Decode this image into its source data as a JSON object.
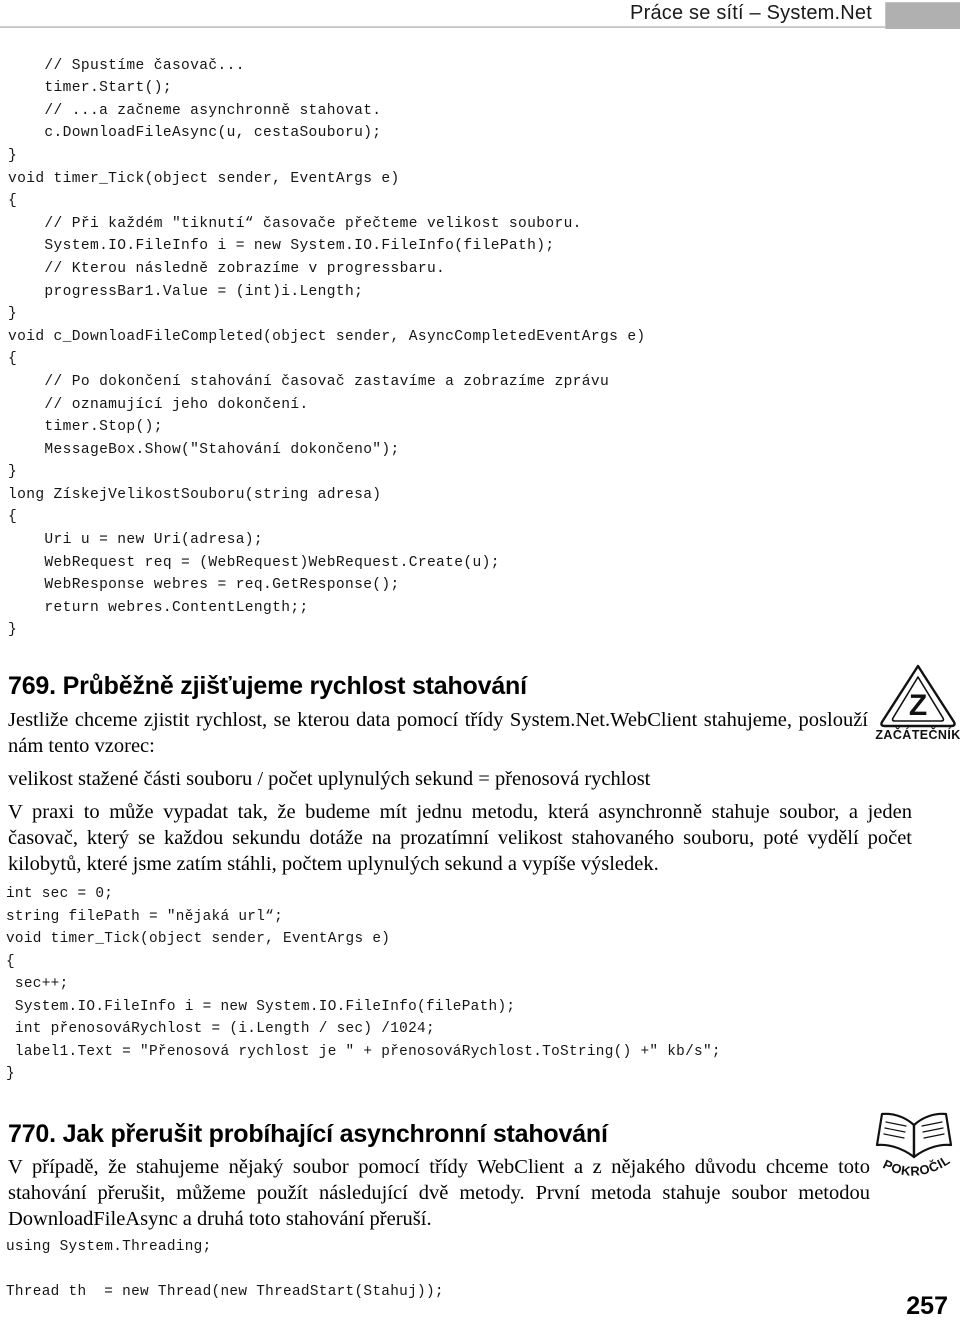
{
  "header": {
    "title": "Práce se sítí – System.Net",
    "tab_color": "#b0b0b0"
  },
  "code_block_1": "    // Spustíme časovač...\n    timer.Start();\n    // ...a začneme asynchronně stahovat.\n    c.DownloadFileAsync(u, cestaSouboru);\n}\nvoid timer_Tick(object sender, EventArgs e)\n{\n    // Při každém \"tiknutí“ časovače přečteme velikost souboru.\n    System.IO.FileInfo i = new System.IO.FileInfo(filePath);\n    // Kterou následně zobrazíme v progressbaru.\n    progressBar1.Value = (int)i.Length;\n}\nvoid c_DownloadFileCompleted(object sender, AsyncCompletedEventArgs e)\n{\n    // Po dokončení stahování časovač zastavíme a zobrazíme zprávu\n    // oznamující jeho dokončení.\n    timer.Stop();\n    MessageBox.Show(\"Stahování dokončeno\");\n}\nlong ZískejVelikostSouboru(string adresa)\n{\n    Uri u = new Uri(adresa);\n    WebRequest req = (WebRequest)WebRequest.Create(u);\n    WebResponse webres = req.GetResponse();\n    return webres.ContentLength;;\n}",
  "section_769": {
    "heading": "769. Průběžně zjišťujeme rychlost stahování",
    "paragraph_1": "Jestliže chceme zjistit rychlost, se kterou data pomocí třídy System.Net.WebClient stahujeme, poslouží nám tento vzorec:",
    "formula": "velikost stažené části souboru / počet uplynulých sekund = přenosová rychlost",
    "paragraph_2": "V praxi to může vypadat tak, že budeme mít jednu metodu, která asynchronně stahuje soubor, a jeden časovač, který se každou sekundu dotáže na prozatímní velikost stahovaného souboru, poté vydělí počet kilobytů, které jsme zatím stáhli, počtem uplynulých sekund a vypíše výsledek."
  },
  "code_block_2": "int sec = 0;\nstring filePath = \"nějaká url“;\nvoid timer_Tick(object sender, EventArgs e)\n{\n sec++;\n System.IO.FileInfo i = new System.IO.FileInfo(filePath);\n int přenosováRychlost = (i.Length / sec) /1024;\n label1.Text = \"Přenosová rychlost je \" + přenosováRychlost.ToString() +\" kb/s\";\n}",
  "section_770": {
    "heading": "770. Jak přerušit probíhající asynchronní stahování",
    "paragraph_1": "V případě, že stahujeme nějaký soubor pomocí třídy WebClient a z nějakého důvodu chceme toto stahování přerušit, můžeme použít následující dvě metody. První metoda stahuje soubor metodou DownloadFileAsync a druhá toto stahování přeruší."
  },
  "code_block_3": "using System.Threading;\n\nThread th  = new Thread(new ThreadStart(Stahuj));",
  "icons": {
    "beginner_label": "ZAČÁTEČNÍK",
    "beginner_glyph": "Z",
    "advanced_label": "POKROČILÝ"
  },
  "folio": "257"
}
